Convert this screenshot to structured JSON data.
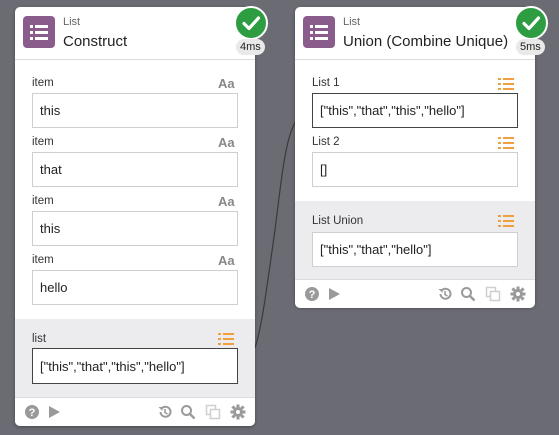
{
  "nodes": {
    "construct": {
      "category": "List",
      "title": "Construct",
      "time": "4ms",
      "inputs": [
        {
          "label": "item",
          "value": "this"
        },
        {
          "label": "item",
          "value": "that"
        },
        {
          "label": "item",
          "value": "this"
        },
        {
          "label": "item",
          "value": "hello"
        }
      ],
      "output": {
        "label": "list",
        "value": "[\"this\",\"that\",\"this\",\"hello\"]"
      },
      "icons": {
        "text_type": "Aa"
      }
    },
    "union": {
      "category": "List",
      "title": "Union (Combine Unique)",
      "time": "5ms",
      "inputs": [
        {
          "label": "List 1",
          "value": "[\"this\",\"that\",\"this\",\"hello\"]"
        },
        {
          "label": "List 2",
          "value": "[]"
        }
      ],
      "output": {
        "label": "List Union",
        "value": "[\"this\",\"that\",\"hello\"]"
      }
    }
  },
  "colors": {
    "canvas": "#6b6b73",
    "node_icon": "#8a5c8c",
    "success": "#2e9d42",
    "list_type_icon": "#f0a040"
  },
  "toolbar_icons": [
    "help-icon",
    "play-icon",
    "history-icon",
    "search-icon",
    "copy-icon",
    "gear-icon"
  ]
}
